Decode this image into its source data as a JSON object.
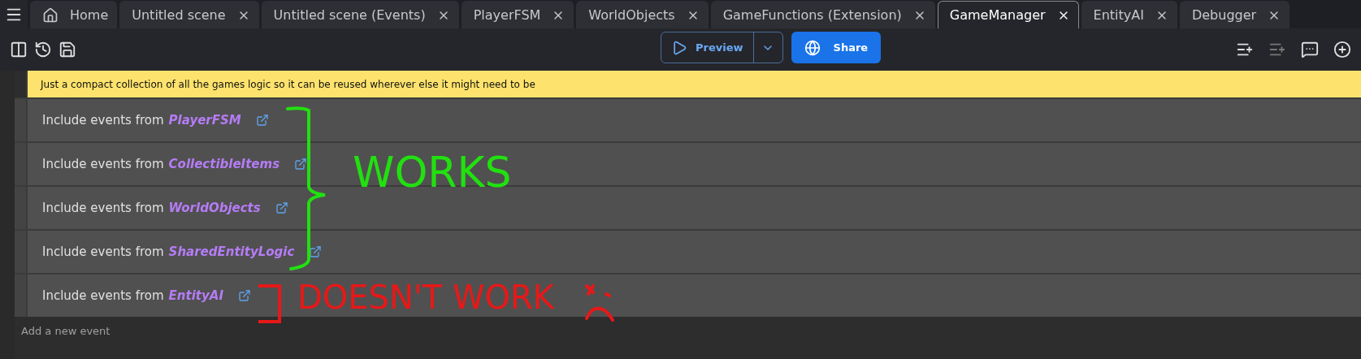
{
  "tabs": [
    {
      "kind": "home",
      "label": "Home",
      "selected": false
    },
    {
      "kind": "doc",
      "label": "Untitled scene",
      "selected": false
    },
    {
      "kind": "doc",
      "label": "Untitled scene (Events)",
      "selected": false
    },
    {
      "kind": "doc",
      "label": "PlayerFSM",
      "selected": false
    },
    {
      "kind": "doc",
      "label": "WorldObjects",
      "selected": false
    },
    {
      "kind": "doc",
      "label": "GameFunctions (Extension)",
      "selected": false
    },
    {
      "kind": "doc",
      "label": "GameManager",
      "selected": true
    },
    {
      "kind": "doc",
      "label": "EntityAI",
      "selected": false
    },
    {
      "kind": "doc",
      "label": "Debugger",
      "selected": false
    }
  ],
  "toolbar": {
    "preview": "Preview",
    "share": "Share"
  },
  "comment": "Just a compact collection of all the games logic so it can be reused wherever else it might need to be",
  "events": [
    {
      "label": "Include events from",
      "target": "PlayerFSM"
    },
    {
      "label": "Include events from",
      "target": "CollectibleItems",
      "note": {
        "kind": "works",
        "text": "WORKS"
      }
    },
    {
      "label": "Include events from",
      "target": "WorldObjects"
    },
    {
      "label": "Include events from",
      "target": "SharedEntityLogic"
    },
    {
      "label": "Include events from",
      "target": "EntityAI",
      "note": {
        "kind": "broken",
        "text": "DOESN'T WORK"
      }
    }
  ],
  "add_event": "Add a new event"
}
